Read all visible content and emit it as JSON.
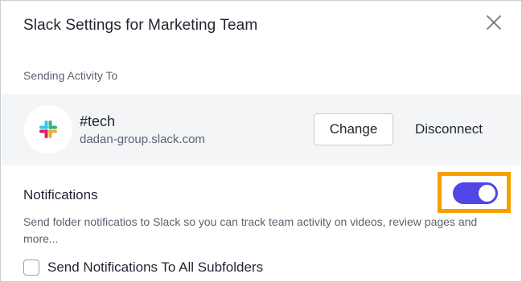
{
  "dialog": {
    "title": "Slack Settings for Marketing Team",
    "close_icon": "close-icon"
  },
  "sending": {
    "section_label": "Sending Activity To",
    "channel": "#tech",
    "workspace": "dadan-group.slack.com",
    "logo_icon": "slack-logo-icon",
    "change_label": "Change",
    "disconnect_label": "Disconnect"
  },
  "notifications": {
    "title": "Notifications",
    "enabled": true,
    "description": "Send folder notificatios to Slack so you can track team activity on videos, review pages and more...",
    "subfolders_label": "Send Notifications To All Subfolders",
    "subfolders_checked": false
  },
  "colors": {
    "toggle_on": "#4f46e5",
    "highlight": "#f5a000",
    "row_background": "#f4f5f7"
  }
}
